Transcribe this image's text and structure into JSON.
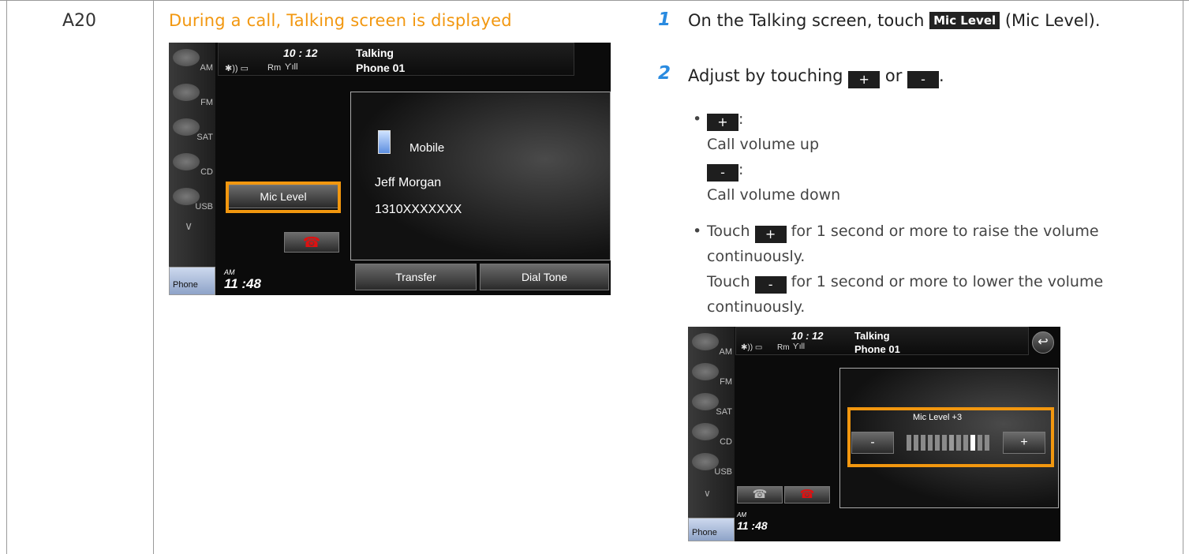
{
  "row_id": "A20",
  "condition": "During a call, Talking screen is displayed",
  "screen1": {
    "time": "10 : 12",
    "status": "Talking",
    "device": "Phone 01",
    "signal": "Rm",
    "sources": [
      "AM",
      "FM",
      "SAT",
      "CD",
      "USB"
    ],
    "contact_type": "Mobile",
    "contact_name": "Jeff Morgan",
    "contact_number": "1310XXXXXXX",
    "mic_level_label": "Mic Level",
    "transfer_label": "Transfer",
    "dial_tone_label": "Dial Tone",
    "clock_ampm": "AM",
    "clock": "11 :48",
    "phone_tab": "Phone"
  },
  "step1": {
    "number": "1",
    "text_before": "On the Talking screen, touch",
    "button": "Mic Level",
    "text_after": "(Mic Level)."
  },
  "step2": {
    "number": "2",
    "text_before": "Adjust by touching",
    "plus": "+",
    "or": "or",
    "minus": "-",
    "end": ".",
    "bullet1_up": "Call volume up",
    "bullet1_down": "Call volume down",
    "bullet2_a": "for 1 second or more to raise the volume",
    "bullet2_b": "for 1 second or more to lower the volume",
    "touch": "Touch",
    "continuously": "continuously."
  },
  "screen2": {
    "time": "10 : 12",
    "status": "Talking",
    "device": "Phone 01",
    "signal": "Rm",
    "sources": [
      "AM",
      "FM",
      "SAT",
      "CD",
      "USB"
    ],
    "mic_level_label": "Mic Level",
    "mic_level_value": "+3",
    "mic_level": 3,
    "clock_ampm": "AM",
    "clock": "11 :48",
    "phone_tab": "Phone"
  },
  "colors": {
    "highlight": "#f2970f",
    "step_number": "#2a8be0"
  }
}
